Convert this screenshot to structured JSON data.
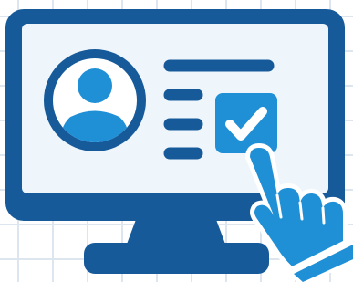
{
  "illustration": {
    "subject": "computer-monitor-with-profile-checkbox-and-pointing-hand",
    "icons": [
      "monitor-icon",
      "user-avatar-icon",
      "text-line-icon",
      "checkbox-checked-icon",
      "pointing-hand-icon"
    ],
    "checkbox_checked": true
  },
  "colors": {
    "background": "#ffffff",
    "grid_line": "#dde5ef",
    "navy": "#175a9a",
    "blue": "#1f8fd6",
    "light_blue": "#eef6fc",
    "white": "#ffffff"
  }
}
